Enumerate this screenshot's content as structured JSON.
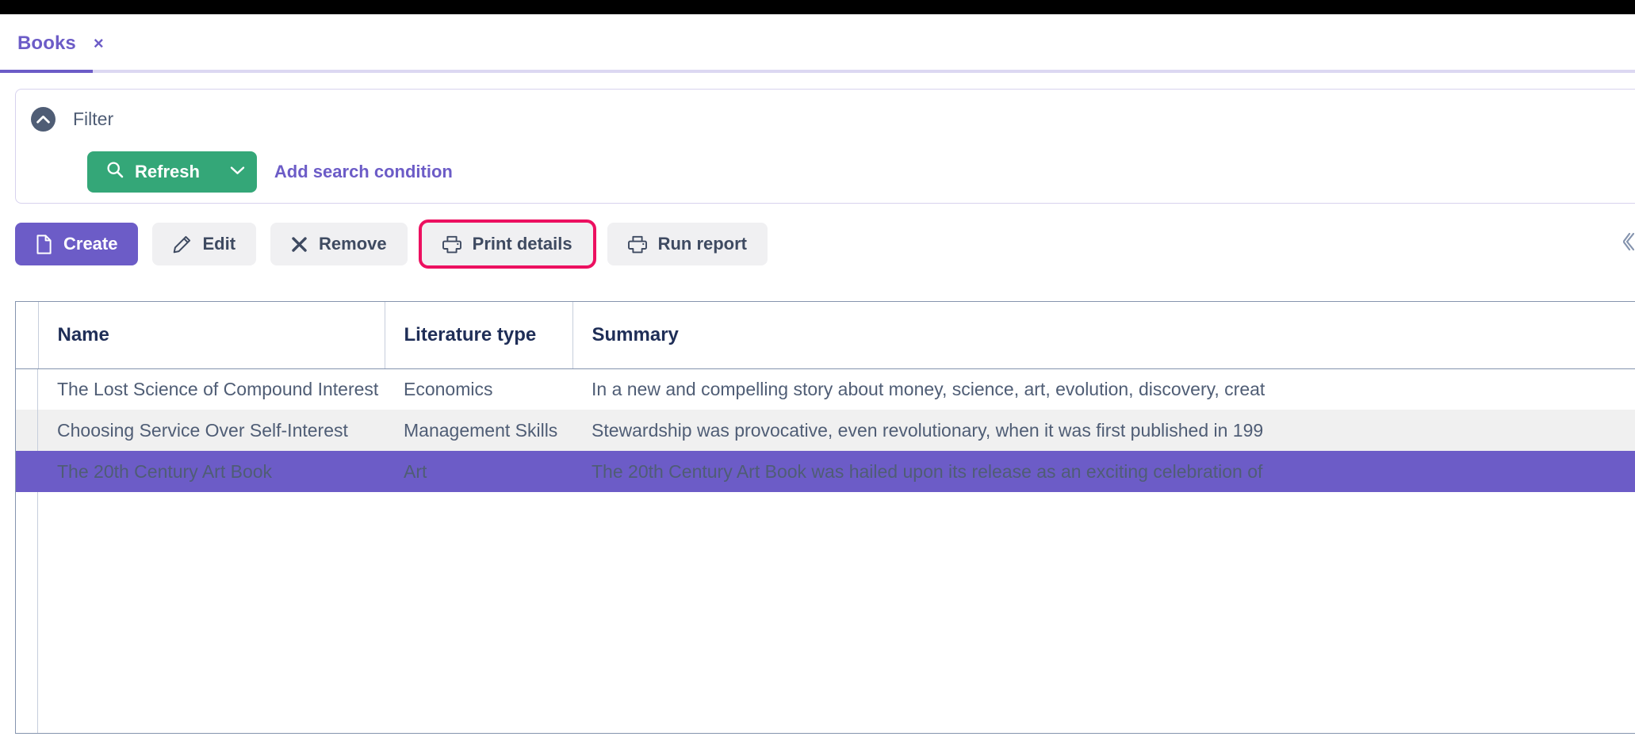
{
  "window": {
    "title_bar_color": "#000000"
  },
  "tabs": [
    {
      "label": "Books",
      "close_glyph": "×",
      "active": true
    }
  ],
  "filter_panel": {
    "title": "Filter",
    "collapse_icon": "chevron-up-circle-icon",
    "refresh_button": {
      "label": "Refresh",
      "icon": "search-icon",
      "dropdown_icon": "chevron-down-icon",
      "color": "#34A778"
    },
    "add_condition_link": {
      "label": "Add search condition",
      "color": "#6C5CC7"
    }
  },
  "action_bar": {
    "buttons": [
      {
        "label": "Create",
        "icon": "file-icon",
        "style": "primary",
        "highlighted": false
      },
      {
        "label": "Edit",
        "icon": "pencil-icon",
        "style": "secondary",
        "highlighted": false
      },
      {
        "label": "Remove",
        "icon": "cross-icon",
        "style": "secondary",
        "highlighted": false
      },
      {
        "label": "Print details",
        "icon": "printer-icon",
        "style": "secondary",
        "highlighted": true
      },
      {
        "label": "Run report",
        "icon": "printer-icon",
        "style": "secondary",
        "highlighted": false
      }
    ],
    "highlight_color": "#EC1060",
    "primary_color": "#6C5CC7"
  },
  "edge_handle": {
    "icon": "chevron-double-left-icon"
  },
  "grid": {
    "columns": [
      {
        "key": "select",
        "label": ""
      },
      {
        "key": "name",
        "label": "Name"
      },
      {
        "key": "lit_type",
        "label": "Literature type"
      },
      {
        "key": "summary",
        "label": "Summary"
      }
    ],
    "rows": [
      {
        "name": "The Lost Science of Compound Interest",
        "lit_type": "Economics",
        "summary": "In a new and compelling story about money, science, art, evolution, discovery, creat",
        "selected": false
      },
      {
        "name": "Choosing Service Over Self-Interest",
        "lit_type": "Management Skills",
        "summary": "Stewardship was provocative, even revolutionary, when it was first published in 199",
        "selected": false
      },
      {
        "name": "The 20th Century Art Book",
        "lit_type": "Art",
        "summary": "The 20th Century Art Book was hailed upon its release as an exciting celebration of",
        "selected": true
      }
    ],
    "selected_row_color": "#6C5CC7",
    "stripe_color": "#F0F0F0"
  }
}
